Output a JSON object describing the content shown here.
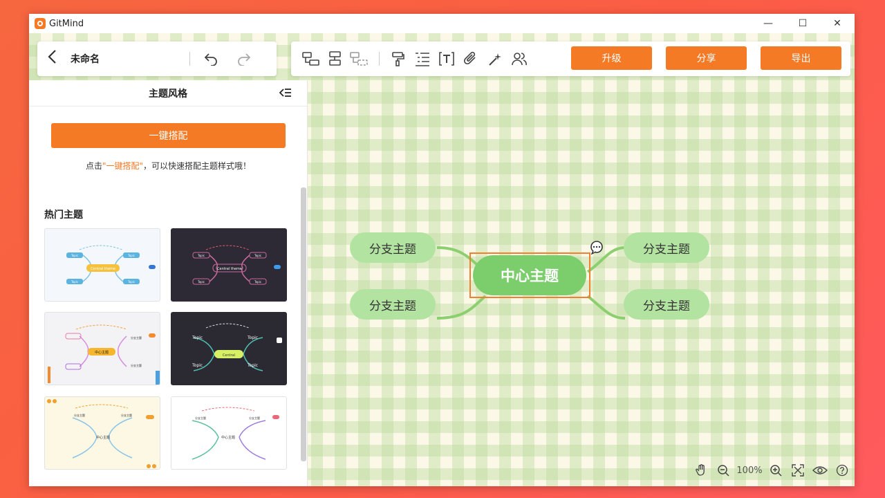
{
  "window": {
    "app_title": "GitMind",
    "controls": {
      "minimize": "—",
      "maximize": "☐",
      "close": "✕"
    }
  },
  "header": {
    "doc_title": "未命名",
    "actions": {
      "upgrade": "升级",
      "share": "分享",
      "export": "导出"
    }
  },
  "toolbar_icons": [
    "child-topic-icon",
    "sibling-topic-icon",
    "summary-topic-icon",
    "format-painter-icon",
    "outline-icon",
    "text-icon",
    "attachment-icon",
    "magic-icon",
    "collaborators-icon"
  ],
  "panel": {
    "title": "主题风格",
    "one_click_button": "一键搭配",
    "hint_prefix": "点击",
    "hint_highlight": "\"一键搭配\"",
    "hint_suffix": "，可以快速搭配主题样式哦！",
    "section_title": "热门主题",
    "themes": [
      {
        "name": "light-blue",
        "center": "Central theme",
        "topic": "Topic",
        "bg": "#f4f7fb"
      },
      {
        "name": "dark-pink",
        "center": "Central theme",
        "topic": "Topic",
        "bg": "#2d2a36"
      },
      {
        "name": "rainbow",
        "center": "中心主题",
        "topic": "分支主题",
        "bg": "#f3f3f5"
      },
      {
        "name": "dark-green",
        "center": "Central",
        "topic": "Topic",
        "bg": "#2b2a33"
      },
      {
        "name": "warm-yellow",
        "center": "中心主题",
        "topic": "分支主题",
        "bg": "#fdf8e4"
      },
      {
        "name": "gradient-white",
        "center": "中心主题",
        "topic": "分支主题",
        "bg": "#ffffff"
      }
    ]
  },
  "mindmap": {
    "center": "中心主题",
    "branches": [
      "分支主题",
      "分支主题",
      "分支主题",
      "分支主题"
    ],
    "colors": {
      "center": "#7ccd6c",
      "branch": "#b2e3a1",
      "line": "#8bcf6e",
      "selection": "#f08030"
    }
  },
  "status": {
    "zoom": "100%"
  },
  "accent": "#f47a25"
}
